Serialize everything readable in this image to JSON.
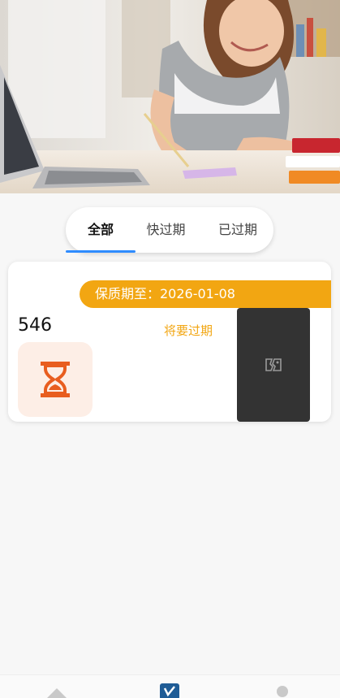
{
  "hero": {
    "icon": "hero-photo"
  },
  "tabs": [
    {
      "label": "全部",
      "active": true
    },
    {
      "label": "快过期",
      "active": false
    },
    {
      "label": "已过期",
      "active": false
    }
  ],
  "card": {
    "expiry_text": "保质期至：2026-01-08",
    "count": "546",
    "status": "将要过期",
    "status_color": "#f2a612",
    "icon": "hourglass-icon",
    "thumbnail_icon": "broken-image-icon"
  },
  "bottom_nav": {
    "items": [
      {
        "icon": "home-icon"
      },
      {
        "icon": "list-icon",
        "active": true
      },
      {
        "icon": "profile-icon"
      }
    ]
  }
}
